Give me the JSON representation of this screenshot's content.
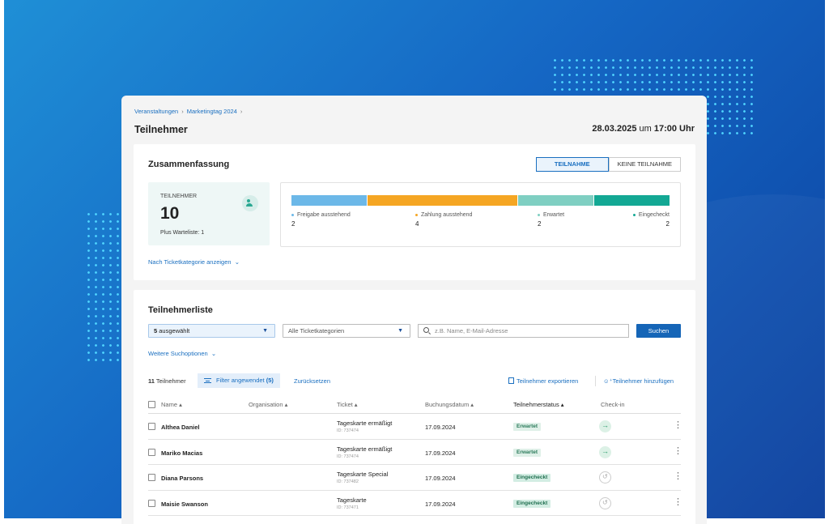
{
  "breadcrumb": [
    "Veranstaltungen",
    "Marketingtag 2024"
  ],
  "breadcrumb_sep": "›",
  "page_title": "Teilnehmer",
  "event_date": {
    "date": "28.03.2025",
    "sep": "um",
    "time": "17:00 Uhr"
  },
  "summary": {
    "title": "Zusammenfassung",
    "toggle": {
      "active": "TEILNAHME",
      "inactive": "KEINE TEILNAHME"
    },
    "stat": {
      "label": "TEILNEHMER",
      "value": "10",
      "sub": "Plus Warteliste: 1"
    },
    "status_colors": [
      "#6cb8e8",
      "#f5a623",
      "#7fcfc2",
      "#13a894"
    ],
    "statuses": [
      {
        "label": "Freigabe ausstehend",
        "count": "2",
        "color": "#6cb8e8"
      },
      {
        "label": "Zahlung ausstehend",
        "count": "4",
        "color": "#f5a623"
      },
      {
        "label": "Erwartet",
        "count": "2",
        "color": "#7fcfc2"
      },
      {
        "label": "Eingecheckt",
        "count": "2",
        "color": "#13a894"
      }
    ],
    "more_link": "Nach Ticketkategorie anzeigen"
  },
  "list": {
    "title": "Teilnehmerliste",
    "status_select": {
      "count": "5",
      "label": "ausgewählt"
    },
    "category_select": "Alle Ticketkategorien",
    "search_placeholder": "z.B. Name, E-Mail-Adresse",
    "search_button": "Suchen",
    "more_options": "Weitere Suchoptionen",
    "count": {
      "num": "11",
      "label": "Teilnehmer"
    },
    "filter_chip": {
      "label": "Filter angewendet",
      "count": "(5)"
    },
    "reset": "Zurücksetzen",
    "export": "Teilnehmer exportieren",
    "add": "Teilnehmer hinzufügen",
    "columns": [
      "Name ▴",
      "Organisation ▴",
      "Ticket ▴",
      "Buchungsdatum ▴",
      "Teilnehmerstatus ▴",
      "Check-in"
    ],
    "rows": [
      {
        "name": "Althea Daniel",
        "ticket": "Tageskarte ermäßigt",
        "ticket_id": "ID: 737474",
        "date": "17.09.2024",
        "status": "Erwartet",
        "checked_in": false
      },
      {
        "name": "Mariko Macias",
        "ticket": "Tageskarte ermäßigt",
        "ticket_id": "ID: 737474",
        "date": "17.09.2024",
        "status": "Erwartet",
        "checked_in": false
      },
      {
        "name": "Diana Parsons",
        "ticket": "Tageskarte Special",
        "ticket_id": "ID: 737482",
        "date": "17.09.2024",
        "status": "Eingecheckt",
        "checked_in": true
      },
      {
        "name": "Maisie Swanson",
        "ticket": "Tageskarte",
        "ticket_id": "ID: 737471",
        "date": "17.09.2024",
        "status": "Eingecheckt",
        "checked_in": true
      }
    ]
  }
}
